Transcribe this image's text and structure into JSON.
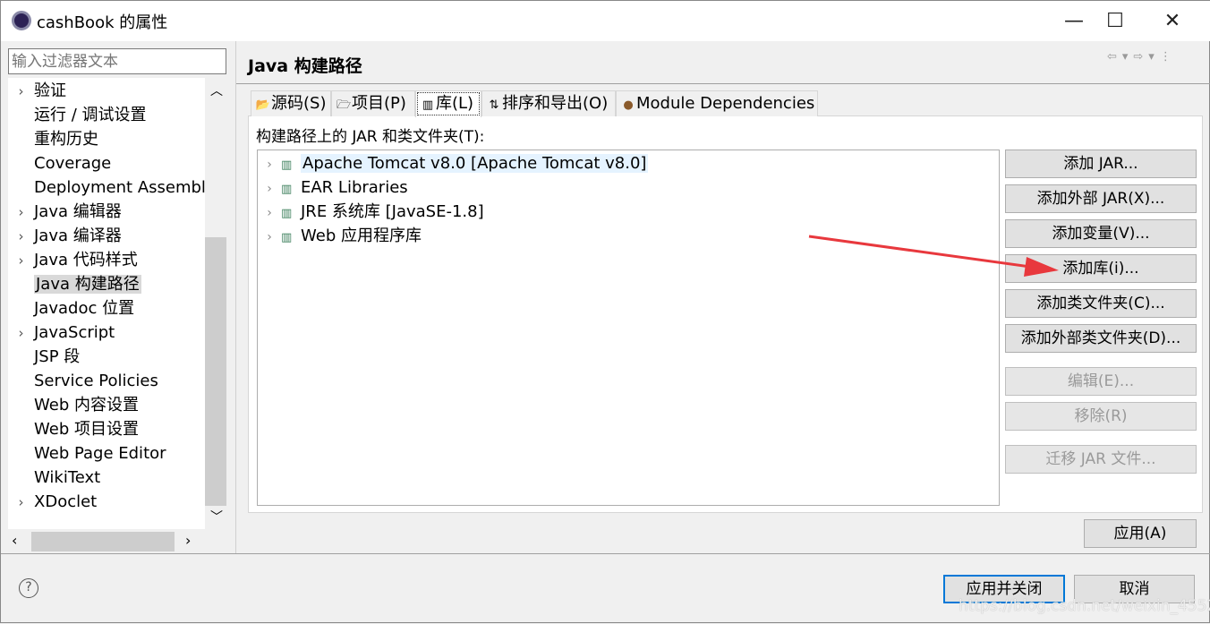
{
  "window": {
    "title": "cashBook 的属性",
    "minimize": "—",
    "maximize": "☐",
    "close": "✕"
  },
  "filter": {
    "placeholder": "输入过滤器文本"
  },
  "nav": [
    {
      "label": "验证",
      "expandable": true
    },
    {
      "label": "运行 / 调试设置",
      "expandable": false
    },
    {
      "label": "重构历史",
      "expandable": false
    },
    {
      "label": "Coverage",
      "expandable": false
    },
    {
      "label": "Deployment Assembly",
      "expandable": false
    },
    {
      "label": "Java 编辑器",
      "expandable": true
    },
    {
      "label": "Java 编译器",
      "expandable": true
    },
    {
      "label": "Java 代码样式",
      "expandable": true
    },
    {
      "label": "Java 构建路径",
      "expandable": false,
      "selected": true
    },
    {
      "label": "Javadoc 位置",
      "expandable": false
    },
    {
      "label": "JavaScript",
      "expandable": true
    },
    {
      "label": "JSP 段",
      "expandable": false
    },
    {
      "label": "Service Policies",
      "expandable": false
    },
    {
      "label": "Web 内容设置",
      "expandable": false
    },
    {
      "label": "Web 项目设置",
      "expandable": false
    },
    {
      "label": "Web Page Editor",
      "expandable": false
    },
    {
      "label": "WikiText",
      "expandable": false
    },
    {
      "label": "XDoclet",
      "expandable": true
    }
  ],
  "page": {
    "title": "Java 构建路径",
    "tabs": [
      {
        "label": "源码(S)",
        "icon": "source-folder-icon"
      },
      {
        "label": "项目(P)",
        "icon": "project-folder-icon"
      },
      {
        "label": "库(L)",
        "icon": "library-icon",
        "active": true
      },
      {
        "label": "排序和导出(O)",
        "icon": "order-export-icon"
      },
      {
        "label": "Module Dependencies",
        "icon": "module-icon"
      }
    ],
    "list_label": "构建路径上的 JAR 和类文件夹(T):",
    "entries": [
      "Apache Tomcat v8.0 [Apache Tomcat v8.0]",
      "EAR Libraries",
      "JRE 系统库 [JavaSE-1.8]",
      "Web 应用程序库"
    ],
    "buttons": [
      {
        "label": "添加 JAR...",
        "enabled": true
      },
      {
        "label": "添加外部 JAR(X)...",
        "enabled": true
      },
      {
        "label": "添加变量(V)...",
        "enabled": true
      },
      {
        "label": "添加库(i)...",
        "enabled": true
      },
      {
        "label": "添加类文件夹(C)...",
        "enabled": true
      },
      {
        "label": "添加外部类文件夹(D)...",
        "enabled": true
      },
      {
        "label": "编辑(E)...",
        "enabled": false
      },
      {
        "label": "移除(R)",
        "enabled": false
      },
      {
        "label": "迁移 JAR 文件...",
        "enabled": false
      }
    ],
    "apply": "应用(A)"
  },
  "footer": {
    "help": "?",
    "apply_close": "应用并关闭",
    "cancel": "取消"
  },
  "watermark": "https://blog.csdn.net/weixin_45525272",
  "colors": {
    "accent": "#0078d7",
    "arrow": "#e8383d"
  }
}
